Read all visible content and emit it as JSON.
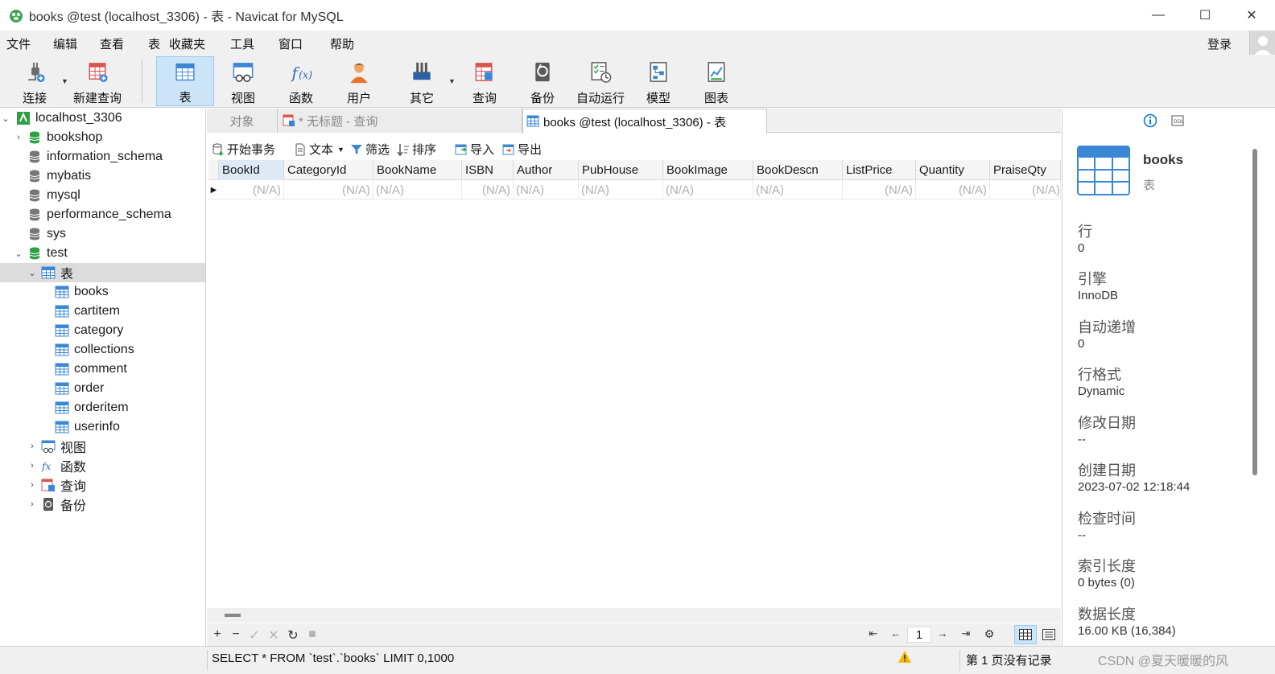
{
  "window": {
    "title": "books @test (localhost_3306) - 表 - Navicat for MySQL",
    "controls": [
      "—",
      "☐",
      "✕"
    ]
  },
  "menu": {
    "items": [
      "文件",
      "编辑",
      "查看",
      "表",
      "收藏夹",
      "工具",
      "窗口",
      "帮助"
    ],
    "login": "登录"
  },
  "toolbar": {
    "items": [
      {
        "label": "连接",
        "icon": "plug-icon"
      },
      {
        "label": "新建查询",
        "icon": "new-query-icon"
      },
      {
        "label": "表",
        "icon": "table-icon",
        "active": true
      },
      {
        "label": "视图",
        "icon": "view-icon"
      },
      {
        "label": "函数",
        "icon": "function-icon"
      },
      {
        "label": "用户",
        "icon": "user-icon"
      },
      {
        "label": "其它",
        "icon": "tools-icon"
      },
      {
        "label": "查询",
        "icon": "query-icon"
      },
      {
        "label": "备份",
        "icon": "backup-icon"
      },
      {
        "label": "自动运行",
        "icon": "automation-icon"
      },
      {
        "label": "模型",
        "icon": "model-icon"
      },
      {
        "label": "图表",
        "icon": "chart-icon"
      }
    ]
  },
  "tree": {
    "connection": "localhost_3306",
    "databases": [
      "bookshop",
      "information_schema",
      "mybatis",
      "mysql",
      "performance_schema",
      "sys",
      "test"
    ],
    "tables_folder": "表",
    "tables": [
      "books",
      "cartitem",
      "category",
      "collections",
      "comment",
      "order",
      "orderitem",
      "userinfo"
    ],
    "folders": [
      "视图",
      "函数",
      "查询",
      "备份"
    ]
  },
  "tabs": {
    "objects": "对象",
    "untitled_query": "* 无标题 - 查询",
    "current": "books @test (localhost_3306) - 表"
  },
  "subtoolbar": {
    "begin_transaction": "开始事务",
    "text": "文本",
    "filter": "筛选",
    "sort": "排序",
    "import": "导入",
    "export": "导出"
  },
  "grid": {
    "columns": [
      "BookId",
      "CategoryId",
      "BookName",
      "ISBN",
      "Author",
      "PubHouse",
      "BookImage",
      "BookDescn",
      "ListPrice",
      "Quantity",
      "PraiseQty"
    ],
    "null_text": "(N/A)"
  },
  "pager": {
    "page": "1"
  },
  "status": {
    "sql": "SELECT * FROM `test`.`books` LIMIT 0,1000",
    "message": "第 1 页没有记录",
    "watermark": "CSDN @夏天暖暖的风"
  },
  "info": {
    "name": "books",
    "type": "表",
    "fields": [
      {
        "label": "行",
        "value": "0"
      },
      {
        "label": "引擎",
        "value": "InnoDB"
      },
      {
        "label": "自动递增",
        "value": "0"
      },
      {
        "label": "行格式",
        "value": "Dynamic"
      },
      {
        "label": "修改日期",
        "value": "--"
      },
      {
        "label": "创建日期",
        "value": "2023-07-02 12:18:44"
      },
      {
        "label": "检查时间",
        "value": "--"
      },
      {
        "label": "索引长度",
        "value": "0 bytes (0)"
      },
      {
        "label": "数据长度",
        "value": "16.00 KB (16,384)"
      }
    ]
  },
  "colors": {
    "accent": "#0078d7",
    "db_green": "#2ea043",
    "table_blue": "#3a87d6",
    "selected_bg": "#dcdcdc"
  }
}
